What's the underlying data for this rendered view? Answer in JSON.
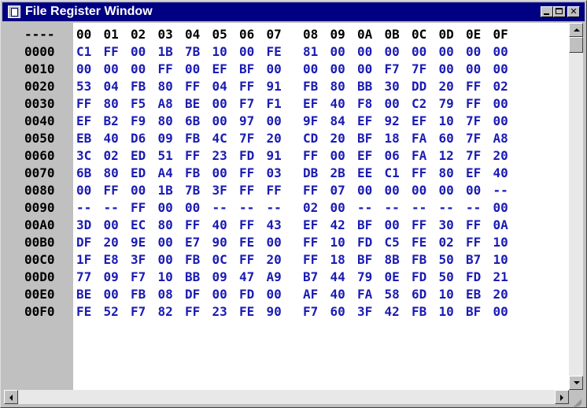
{
  "window": {
    "title": "File Register Window"
  },
  "header": {
    "label": "----",
    "columns": [
      "00",
      "01",
      "02",
      "03",
      "04",
      "05",
      "06",
      "07",
      "08",
      "09",
      "0A",
      "0B",
      "0C",
      "0D",
      "0E",
      "0F"
    ]
  },
  "rows": [
    {
      "address": "0000",
      "cells": [
        "C1",
        "FF",
        "00",
        "1B",
        "7B",
        "10",
        "00",
        "FE",
        "81",
        "00",
        "00",
        "00",
        "00",
        "00",
        "00",
        "00"
      ]
    },
    {
      "address": "0010",
      "cells": [
        "00",
        "00",
        "00",
        "FF",
        "00",
        "EF",
        "BF",
        "00",
        "00",
        "00",
        "00",
        "F7",
        "7F",
        "00",
        "00",
        "00"
      ]
    },
    {
      "address": "0020",
      "cells": [
        "53",
        "04",
        "FB",
        "80",
        "FF",
        "04",
        "FF",
        "91",
        "FB",
        "80",
        "BB",
        "30",
        "DD",
        "20",
        "FF",
        "02"
      ]
    },
    {
      "address": "0030",
      "cells": [
        "FF",
        "80",
        "F5",
        "A8",
        "BE",
        "00",
        "F7",
        "F1",
        "EF",
        "40",
        "F8",
        "00",
        "C2",
        "79",
        "FF",
        "00"
      ]
    },
    {
      "address": "0040",
      "cells": [
        "EF",
        "B2",
        "F9",
        "80",
        "6B",
        "00",
        "97",
        "00",
        "9F",
        "84",
        "EF",
        "92",
        "EF",
        "10",
        "7F",
        "00"
      ]
    },
    {
      "address": "0050",
      "cells": [
        "EB",
        "40",
        "D6",
        "09",
        "FB",
        "4C",
        "7F",
        "20",
        "CD",
        "20",
        "BF",
        "18",
        "FA",
        "60",
        "7F",
        "A8"
      ]
    },
    {
      "address": "0060",
      "cells": [
        "3C",
        "02",
        "ED",
        "51",
        "FF",
        "23",
        "FD",
        "91",
        "FF",
        "00",
        "EF",
        "06",
        "FA",
        "12",
        "7F",
        "20"
      ]
    },
    {
      "address": "0070",
      "cells": [
        "6B",
        "80",
        "ED",
        "A4",
        "FB",
        "00",
        "FF",
        "03",
        "DB",
        "2B",
        "EE",
        "C1",
        "FF",
        "80",
        "EF",
        "40"
      ]
    },
    {
      "address": "0080",
      "cells": [
        "00",
        "FF",
        "00",
        "1B",
        "7B",
        "3F",
        "FF",
        "FF",
        "FF",
        "07",
        "00",
        "00",
        "00",
        "00",
        "00",
        "--"
      ]
    },
    {
      "address": "0090",
      "cells": [
        "--",
        "--",
        "FF",
        "00",
        "00",
        "--",
        "--",
        "--",
        "02",
        "00",
        "--",
        "--",
        "--",
        "--",
        "--",
        "00"
      ]
    },
    {
      "address": "00A0",
      "cells": [
        "3D",
        "00",
        "EC",
        "80",
        "FF",
        "40",
        "FF",
        "43",
        "EF",
        "42",
        "BF",
        "00",
        "FF",
        "30",
        "FF",
        "0A"
      ]
    },
    {
      "address": "00B0",
      "cells": [
        "DF",
        "20",
        "9E",
        "00",
        "E7",
        "90",
        "FE",
        "00",
        "FF",
        "10",
        "FD",
        "C5",
        "FE",
        "02",
        "FF",
        "10"
      ]
    },
    {
      "address": "00C0",
      "cells": [
        "1F",
        "E8",
        "3F",
        "00",
        "FB",
        "0C",
        "FF",
        "20",
        "FF",
        "18",
        "BF",
        "8B",
        "FB",
        "50",
        "B7",
        "10"
      ]
    },
    {
      "address": "00D0",
      "cells": [
        "77",
        "09",
        "F7",
        "10",
        "BB",
        "09",
        "47",
        "A9",
        "B7",
        "44",
        "79",
        "0E",
        "FD",
        "50",
        "FD",
        "21"
      ]
    },
    {
      "address": "00E0",
      "cells": [
        "BE",
        "00",
        "FB",
        "08",
        "DF",
        "00",
        "FD",
        "00",
        "AF",
        "40",
        "FA",
        "58",
        "6D",
        "10",
        "EB",
        "20"
      ]
    },
    {
      "address": "00F0",
      "cells": [
        "FE",
        "52",
        "F7",
        "82",
        "FF",
        "23",
        "FE",
        "90",
        "F7",
        "60",
        "3F",
        "42",
        "FB",
        "10",
        "BF",
        "00"
      ]
    }
  ],
  "icons": {
    "system": "document-icon",
    "minimize": "minimize-icon",
    "maximize": "maximize-icon",
    "close": "close-icon"
  },
  "colors": {
    "titlebar": "#000082",
    "address_text": "#000000",
    "value_text": "#1b1bb4",
    "gutter": "#c0c0c0"
  }
}
